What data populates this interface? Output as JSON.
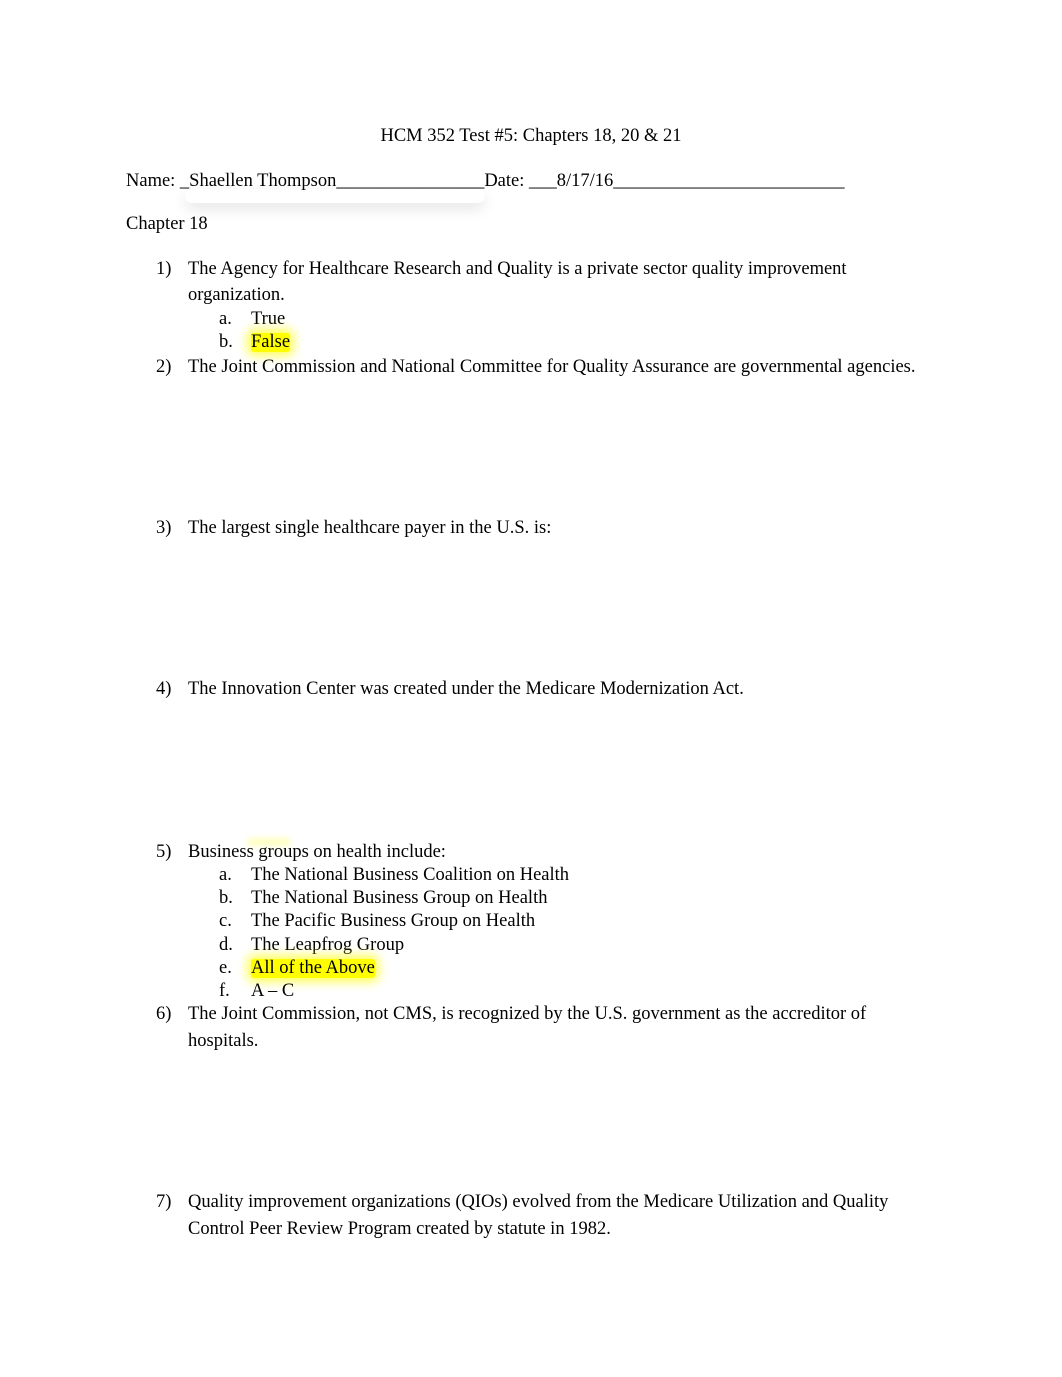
{
  "document": {
    "title": "HCM 352 Test #5: Chapters 18, 20 & 21",
    "name_line": "Name: _Shaellen Thompson________________Date: ___8/17/16_________________________",
    "section": "Chapter 18",
    "questions": [
      {
        "number": "1)",
        "text_line1": "The Agency for Healthcare Research and Quality is a private sector quality improvement",
        "text_line2": "organization.",
        "options": [
          {
            "letter": "a.",
            "text": "True",
            "highlighted": false
          },
          {
            "letter": "b.",
            "text": "False",
            "highlighted": true
          }
        ]
      },
      {
        "number": "2)",
        "text_line1": "The Joint Commission and National Committee for Quality Assurance are governmental agencies."
      },
      {
        "number": "3)",
        "text_line1": "The largest single healthcare payer in the U.S. is:"
      },
      {
        "number": "4)",
        "text_line1": "The Innovation Center was created under the Medicare Modernization Act."
      },
      {
        "number": "5)",
        "text_line1": "Business groups on health include:",
        "options": [
          {
            "letter": "a.",
            "text": "The National Business Coalition on Health",
            "highlighted": false
          },
          {
            "letter": "b.",
            "text": "The National Business Group on Health",
            "highlighted": false
          },
          {
            "letter": "c.",
            "text": "The Pacific Business Group on Health",
            "highlighted": false
          },
          {
            "letter": "d.",
            "text": "The Leapfrog Group",
            "highlighted": false
          },
          {
            "letter": "e.",
            "text": "All of the Above",
            "highlighted": true
          },
          {
            "letter": "f.",
            "text": "A – C",
            "highlighted": false
          }
        ]
      },
      {
        "number": "6)",
        "text_line1": "The Joint Commission, not CMS, is recognized by the U.S. government as the accreditor of",
        "text_line2": "hospitals."
      },
      {
        "number": "7)",
        "text_line1": "Quality improvement organizations (QIOs) evolved from the Medicare Utilization and Quality",
        "text_line2": "Control Peer Review Program created by statute in 1982."
      }
    ]
  },
  "colors": {
    "highlight": "#ffff00",
    "text": "#000000",
    "page": "#ffffff"
  }
}
